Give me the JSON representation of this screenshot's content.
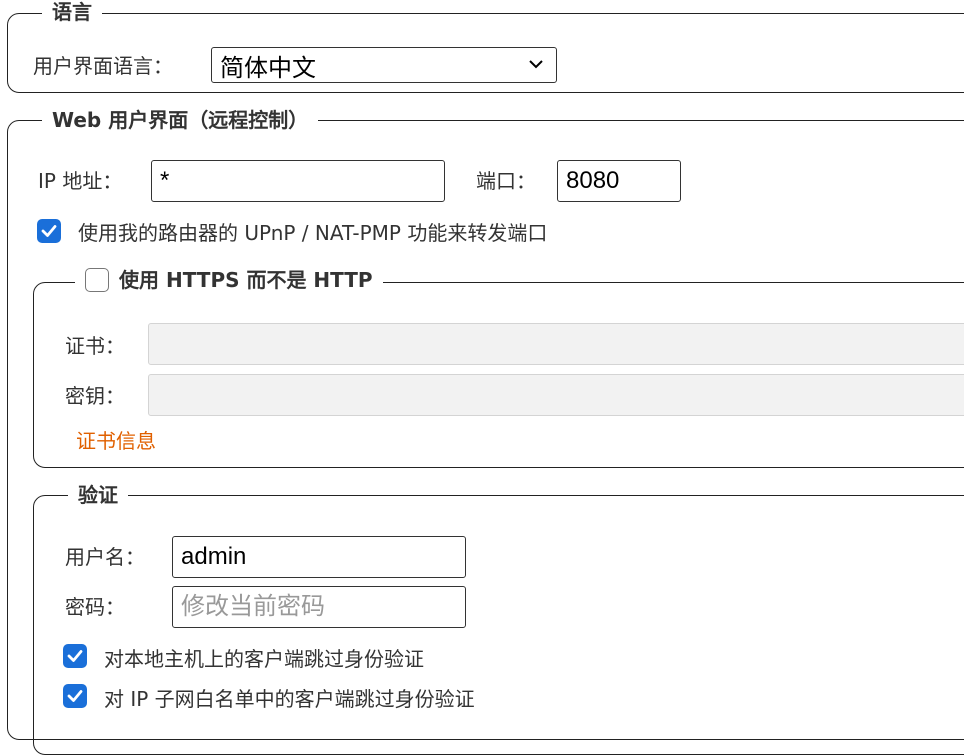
{
  "language": {
    "legend": "语言",
    "ui_language_label": "用户界面语言：",
    "ui_language_value": "简体中文"
  },
  "webui": {
    "legend": "Web 用户界面（远程控制）",
    "ip_label": "IP 地址：",
    "ip_value": "*",
    "port_label": "端口：",
    "port_value": "8080",
    "upnp_label": "使用我的路由器的 UPnP / NAT-PMP 功能来转发端口",
    "upnp_checked": true,
    "https": {
      "legend": "使用 HTTPS 而不是 HTTP",
      "checked": false,
      "cert_label": "证书：",
      "key_label": "密钥：",
      "cert_info_link": "证书信息"
    },
    "auth": {
      "legend": "验证",
      "username_label": "用户名：",
      "username_value": "admin",
      "password_label": "密码：",
      "password_placeholder": "修改当前密码",
      "bypass_localhost_label": "对本地主机上的客户端跳过身份验证",
      "bypass_localhost_checked": true,
      "bypass_whitelist_label": "对 IP 子网白名单中的客户端跳过身份验证",
      "bypass_whitelist_checked": true
    }
  },
  "colors": {
    "accent": "#1a6fd9",
    "link": "#e06000"
  }
}
